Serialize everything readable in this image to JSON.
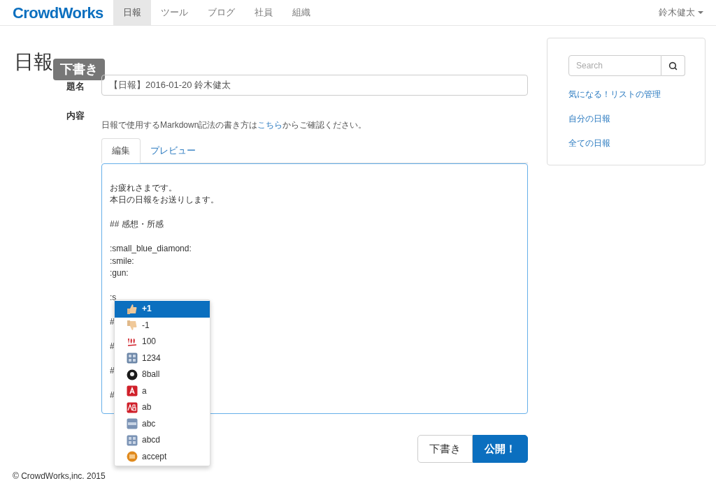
{
  "navbar": {
    "brand": "CrowdWorks",
    "items": [
      {
        "label": "日報",
        "selected": true
      },
      {
        "label": "ツール",
        "selected": false
      },
      {
        "label": "ブログ",
        "selected": false
      },
      {
        "label": "社員",
        "selected": false
      },
      {
        "label": "組織",
        "selected": false
      }
    ],
    "user": "鈴木健太"
  },
  "page": {
    "title": "日報",
    "badge": "下書き"
  },
  "form": {
    "title_label": "題名",
    "title_value": "【日報】2016-01-20 鈴木健太",
    "content_label": "内容",
    "help_before": "日報で使用するMarkdown記法の書き方は",
    "help_link": "こちら",
    "help_after": "からご確認ください。",
    "tabs": [
      {
        "label": "編集",
        "selected": true
      },
      {
        "label": "プレビュー",
        "selected": false
      }
    ],
    "editor_paragraphs": [
      [
        "お疲れさまです。",
        "本日の日報をお送りします。"
      ],
      [
        "## 感想・所感"
      ],
      [
        ":small_blue_diamond:",
        ":smile:",
        ":gun:"
      ],
      [
        ":s"
      ],
      [
        "#"
      ],
      [
        "#"
      ],
      [
        "#"
      ],
      [
        "#"
      ]
    ],
    "suggestions": [
      {
        "label": "+1",
        "selected": true
      },
      {
        "label": "-1",
        "selected": false
      },
      {
        "label": "100",
        "selected": false
      },
      {
        "label": "1234",
        "selected": false
      },
      {
        "label": "8ball",
        "selected": false
      },
      {
        "label": "a",
        "selected": false
      },
      {
        "label": "ab",
        "selected": false
      },
      {
        "label": "abc",
        "selected": false
      },
      {
        "label": "abcd",
        "selected": false
      },
      {
        "label": "accept",
        "selected": false
      }
    ],
    "buttons": [
      {
        "label": "下書き",
        "kind": "default"
      },
      {
        "label": "公開！",
        "kind": "primary"
      }
    ]
  },
  "sidebar": {
    "search_placeholder": "Search",
    "links": [
      "気になる！リストの管理",
      "自分の日報",
      "全ての日報"
    ]
  },
  "footer": "© CrowdWorks,inc. 2015"
}
